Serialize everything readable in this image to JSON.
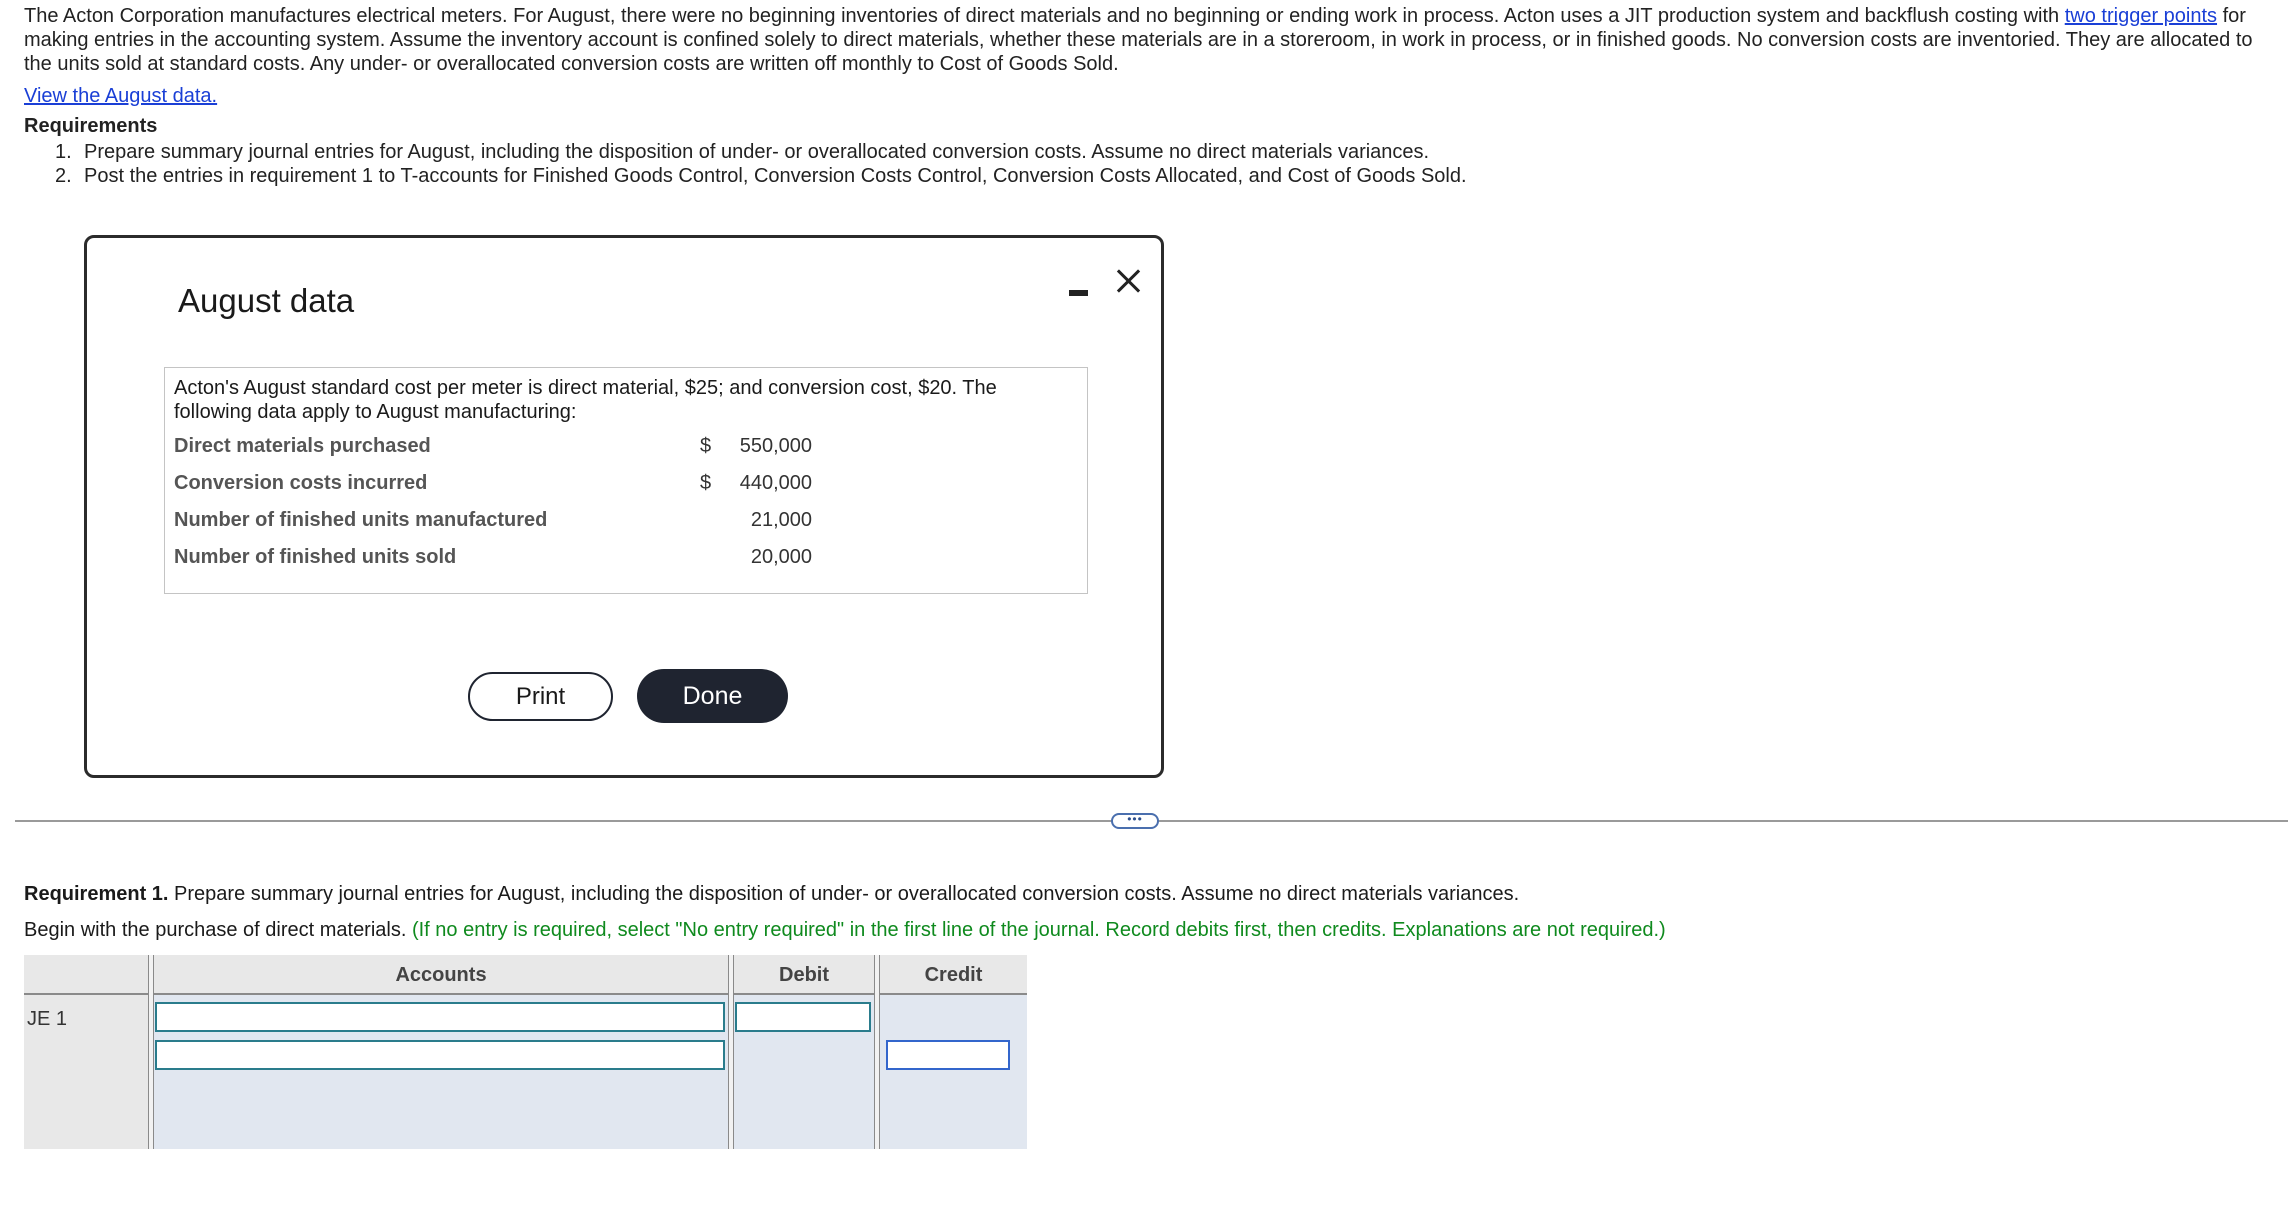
{
  "intro": {
    "text_before_link": "The Acton Corporation manufactures electrical meters. For August, there were no beginning inventories of direct materials and no beginning or ending work in process. Acton uses a JIT production system and backflush costing with ",
    "link_text": "two trigger points",
    "text_after_link": " for making entries in the accounting system. Assume the inventory account is confined solely to direct materials, whether these materials are in a storeroom, in work in process, or in finished goods. No conversion costs are inventoried. They are allocated to the units sold at standard costs. Any under- or overallocated conversion costs are written off monthly to Cost of Goods Sold."
  },
  "view_data_link": "View the August data.",
  "requirements": {
    "heading": "Requirements",
    "items": [
      {
        "num": "1.",
        "text": "Prepare summary journal entries for August, including the disposition of under- or overallocated conversion costs. Assume no direct materials variances."
      },
      {
        "num": "2.",
        "text": "Post the entries in requirement 1 to T-accounts for Finished Goods Control, Conversion Costs Control, Conversion Costs Allocated, and Cost of Goods Sold."
      }
    ]
  },
  "modal": {
    "title": "August data",
    "intro": "Acton's August standard cost per meter is direct material, $25; and conversion cost, $20. The following data apply to August manufacturing:",
    "rows": [
      {
        "label": "Direct materials purchased",
        "currency": "$",
        "value": "550,000"
      },
      {
        "label": "Conversion costs incurred",
        "currency": "$",
        "value": "440,000"
      },
      {
        "label": "Number of finished units manufactured",
        "currency": "",
        "value": "21,000"
      },
      {
        "label": "Number of finished units sold",
        "currency": "",
        "value": "20,000"
      }
    ],
    "print_label": "Print",
    "done_label": "Done"
  },
  "more_handle": "•••",
  "requirement1": {
    "bold": "Requirement 1.",
    "text": " Prepare summary journal entries for August, including the disposition of under- or overallocated conversion costs. Assume no direct materials variances.",
    "begin": "Begin with the purchase of direct materials. ",
    "hint": "(If no entry is required, select \"No entry required\" in the first line of the journal. Record debits first, then credits. Explanations are not required.)"
  },
  "journal": {
    "headers": {
      "accounts": "Accounts",
      "debit": "Debit",
      "credit": "Credit"
    },
    "entry_label": "JE 1",
    "inputs": {
      "account1": "",
      "account2": "",
      "debit1": "",
      "credit2": ""
    }
  },
  "colors": {
    "link": "#1a3fd6",
    "hint_green": "#0f8a1e",
    "done_button": "#1f2430",
    "table_header": "#e8e8e8",
    "table_body": "#e1e7f0"
  }
}
